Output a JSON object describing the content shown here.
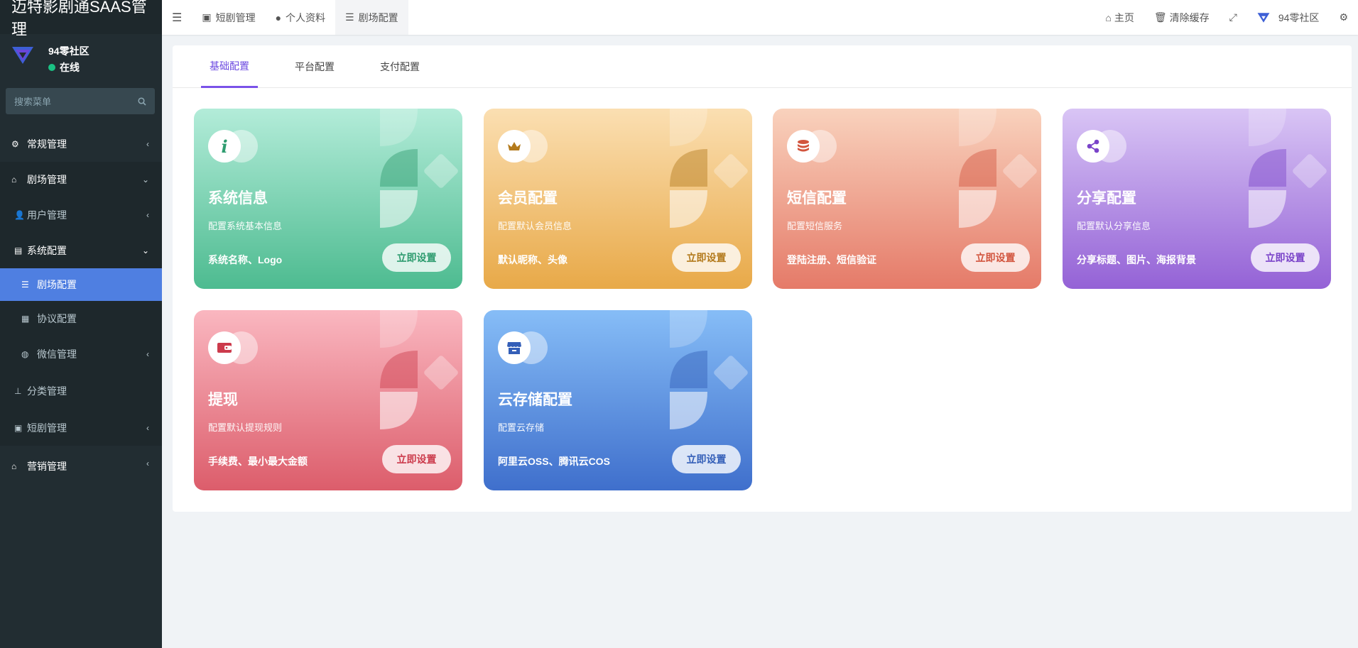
{
  "app": {
    "title": "迈特影剧通SAAS管理"
  },
  "user": {
    "name": "94零社区",
    "status": "在线"
  },
  "search": {
    "placeholder": "搜索菜单"
  },
  "sidebar": {
    "items": [
      {
        "label": "常规管理"
      },
      {
        "label": "剧场管理"
      },
      {
        "label": "用户管理"
      },
      {
        "label": "系统配置"
      },
      {
        "label": "剧场配置"
      },
      {
        "label": "协议配置"
      },
      {
        "label": "微信管理"
      },
      {
        "label": "分类管理"
      },
      {
        "label": "短剧管理"
      },
      {
        "label": "营销管理"
      }
    ]
  },
  "topbar": {
    "tabs": [
      {
        "label": "短剧管理"
      },
      {
        "label": "个人资料"
      },
      {
        "label": "剧场配置"
      }
    ],
    "home": "主页",
    "clear_cache": "清除缓存",
    "user": "94零社区"
  },
  "page": {
    "tabs": [
      {
        "label": "基础配置"
      },
      {
        "label": "平台配置"
      },
      {
        "label": "支付配置"
      }
    ]
  },
  "colors": {
    "sidebar": "#222d32",
    "accent": "#4f7fe1",
    "tab_active": "#6b48e0"
  },
  "cards": [
    {
      "title": "系统信息",
      "desc": "配置系统基本信息",
      "features": "系统名称、Logo",
      "button": "立即设置",
      "icon": "info-icon",
      "color_top": "#b3ecd9",
      "color_bottom": "#4dbb90",
      "btn_color": "#2e9c6f"
    },
    {
      "title": "会员配置",
      "desc": "配置默认会员信息",
      "features": "默认昵称、头像",
      "button": "立即设置",
      "icon": "crown-icon",
      "color_top": "#fbdfb2",
      "color_bottom": "#e8a948",
      "btn_color": "#b37a1c"
    },
    {
      "title": "短信配置",
      "desc": "配置短信服务",
      "features": "登陆注册、短信验证",
      "button": "立即设置",
      "icon": "database-icon",
      "color_top": "#f9d2bd",
      "color_bottom": "#e57a68",
      "btn_color": "#d2553e"
    },
    {
      "title": "分享配置",
      "desc": "配置默认分享信息",
      "features": "分享标题、图片、海报背景",
      "button": "立即设置",
      "icon": "share-icon",
      "color_top": "#d9c5f5",
      "color_bottom": "#9462d6",
      "btn_color": "#7a44c9"
    },
    {
      "title": "提现",
      "desc": "配置默认提现规则",
      "features": "手续费、最小最大金额",
      "button": "立即设置",
      "icon": "wallet-icon",
      "color_top": "#fab7c0",
      "color_bottom": "#dc5d6b",
      "btn_color": "#cc3b4c"
    },
    {
      "title": "云存储配置",
      "desc": "配置云存储",
      "features": "阿里云OSS、腾讯云COS",
      "button": "立即设置",
      "icon": "storefront-icon",
      "color_top": "#86bdf7",
      "color_bottom": "#3f6fcc",
      "btn_color": "#345fb8"
    }
  ]
}
